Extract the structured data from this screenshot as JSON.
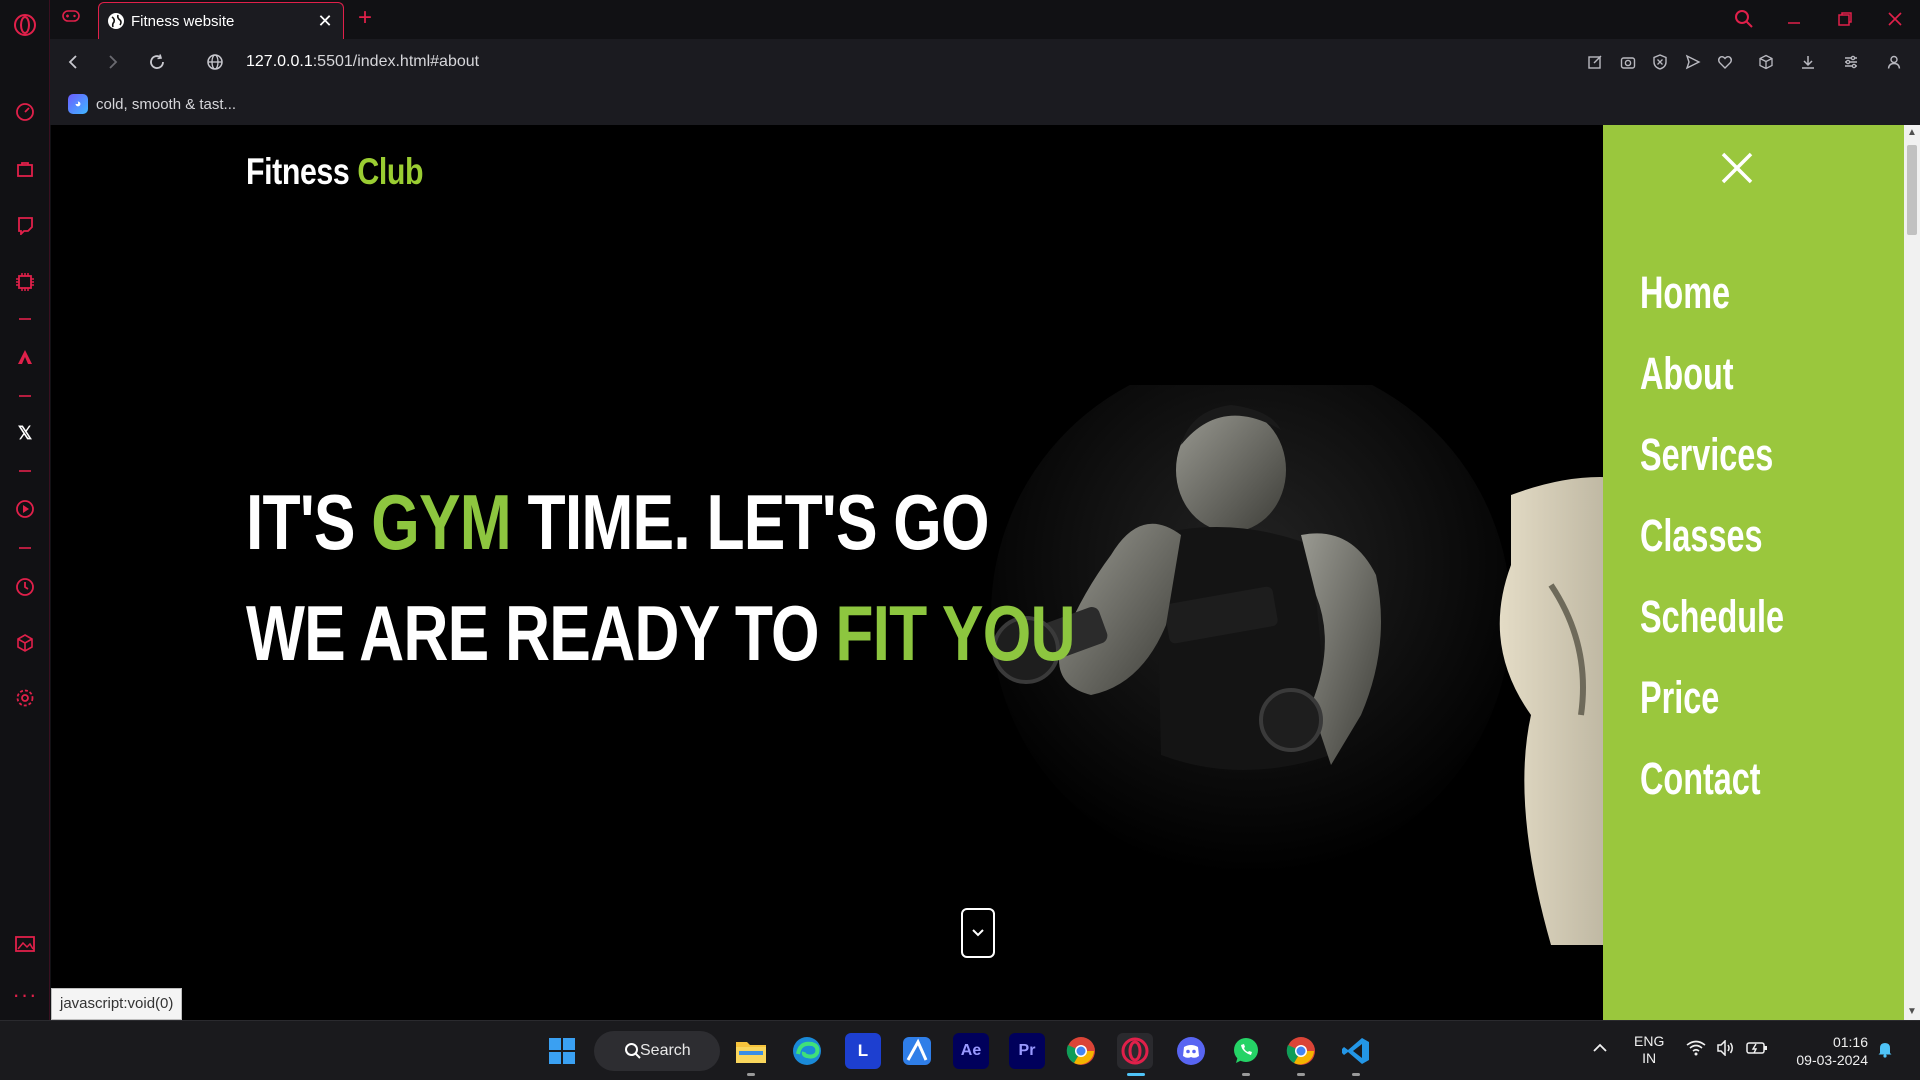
{
  "browser": {
    "tab_title": "Fitness website",
    "url_host": "127.0.0.1",
    "url_rest": ":5501/index.html#about",
    "bookmark_label": "cold, smooth & tast...",
    "status_text": "javascript:void(0)"
  },
  "site": {
    "logo_main": "Fitness",
    "logo_accent": "Club",
    "hero_line1_a": "IT'S",
    "hero_line1_accent": "GYM",
    "hero_line1_b": "TIME. LET'S GO",
    "hero_line2_a": "WE ARE READY TO",
    "hero_line2_accent": "FIT YOU",
    "scroll_down_icon": "chevron-down-icon"
  },
  "menu": {
    "items": [
      "Home",
      "About",
      "Services",
      "Classes",
      "Schedule",
      "Price",
      "Contact"
    ]
  },
  "colors": {
    "accent": "#8dc63f",
    "menu_bg": "#9ac73d",
    "browser_accent": "#e0204a"
  },
  "taskbar": {
    "search_label": "Search",
    "lang_top": "ENG",
    "lang_bottom": "IN",
    "time": "01:16",
    "date": "09-03-2024",
    "apps": [
      "Ae",
      "Pr",
      "L"
    ]
  }
}
